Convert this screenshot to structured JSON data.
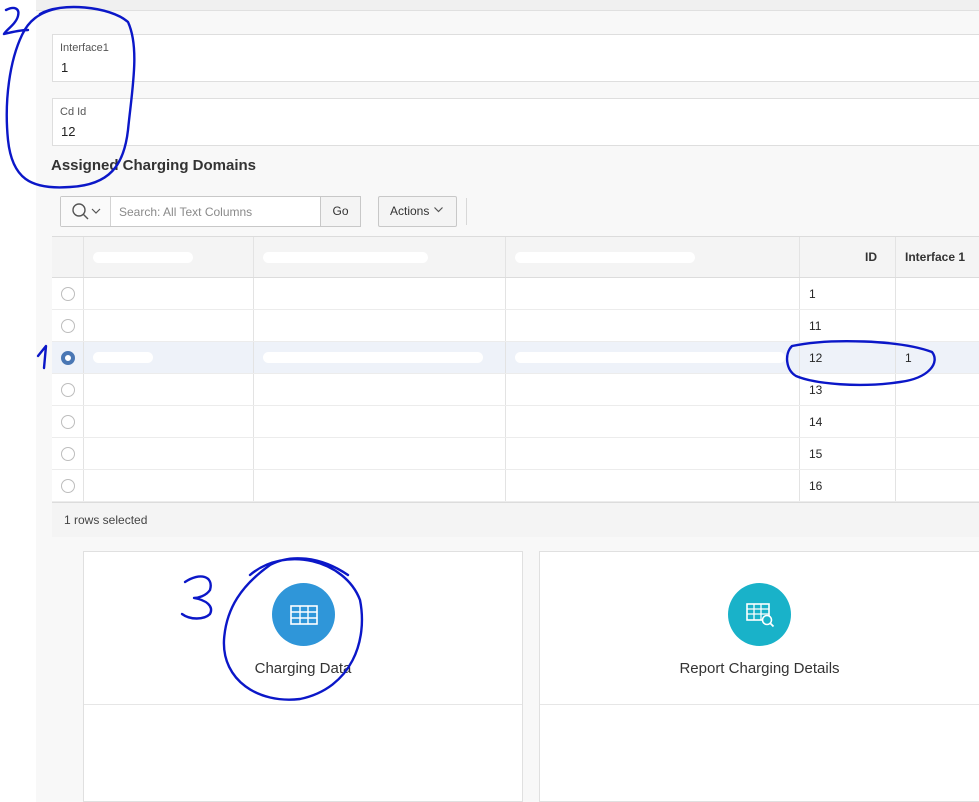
{
  "fields": [
    {
      "label": "Interface1",
      "value": "1"
    },
    {
      "label": "Cd Id",
      "value": "12"
    }
  ],
  "section_title": "Assigned Charging Domains",
  "toolbar": {
    "search_placeholder": "Search: All Text Columns",
    "go_label": "Go",
    "actions_label": "Actions"
  },
  "grid": {
    "headers": [
      "",
      "",
      "",
      "ID",
      "Interface 1"
    ],
    "rows": [
      {
        "id": "1",
        "interface": "",
        "selected": false
      },
      {
        "id": "11",
        "interface": "",
        "selected": false
      },
      {
        "id": "12",
        "interface": "1",
        "selected": true
      },
      {
        "id": "13",
        "interface": "",
        "selected": false
      },
      {
        "id": "14",
        "interface": "",
        "selected": false
      },
      {
        "id": "15",
        "interface": "",
        "selected": false
      },
      {
        "id": "16",
        "interface": "",
        "selected": false
      }
    ],
    "footer": "1 rows selected"
  },
  "cards": [
    {
      "title": "Charging Data",
      "icon": "table-icon",
      "color": "#2f96d9"
    },
    {
      "title": "Report Charging Details",
      "icon": "table-search-icon",
      "color": "#19b2c9"
    }
  ],
  "annotations": [
    "1",
    "2",
    "3"
  ],
  "colors": {
    "accent": "#4a77b4",
    "annotation": "#0b17c8"
  }
}
